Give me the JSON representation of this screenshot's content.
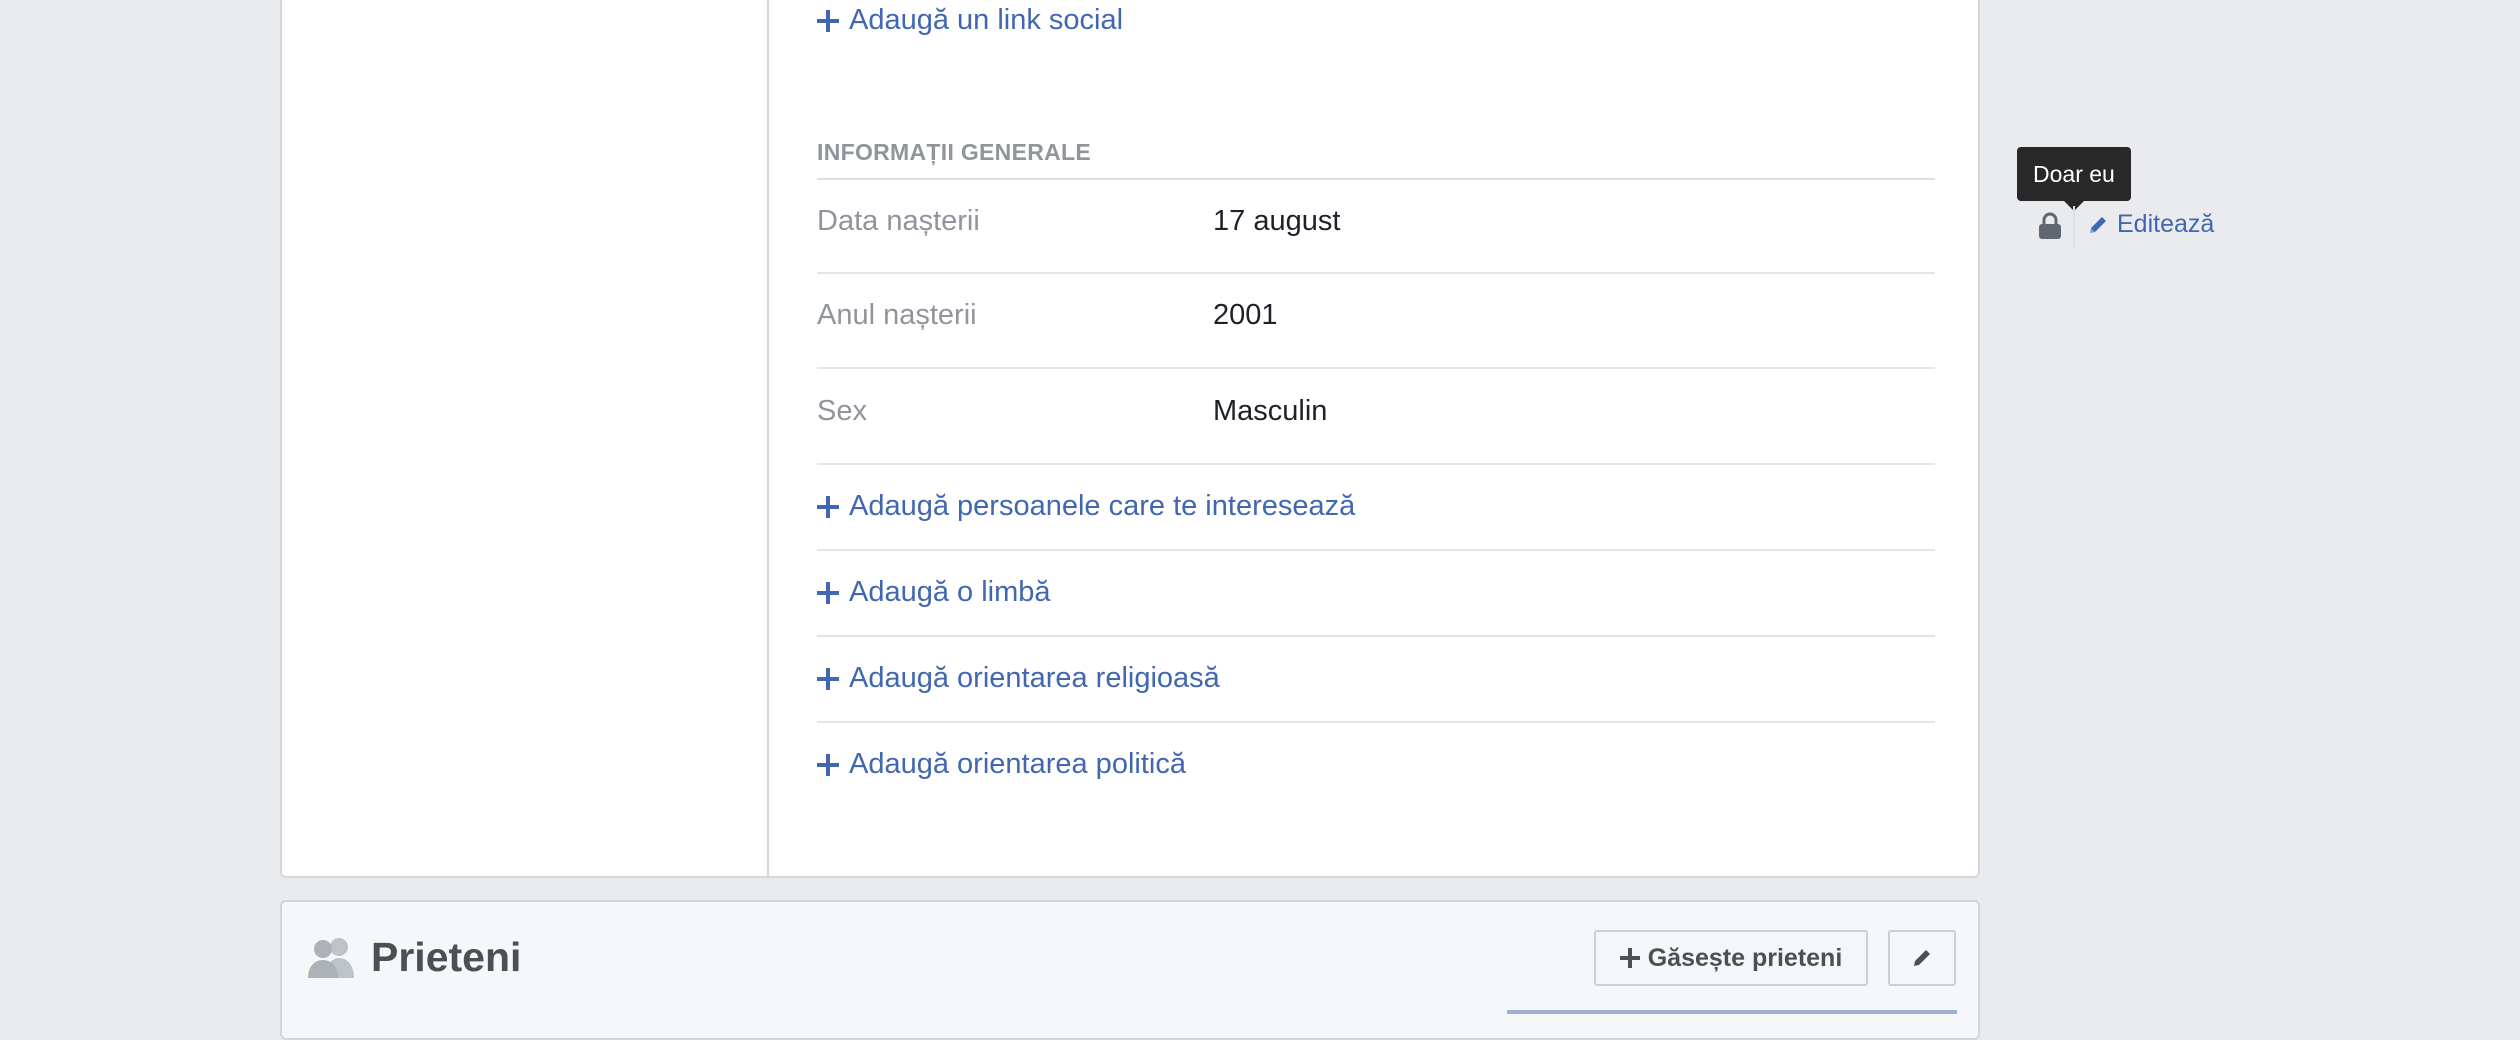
{
  "about": {
    "add_social_link": "Adaugă un link social",
    "section_title": "INFORMAȚII GENERALE",
    "rows": [
      {
        "label": "Data nașterii",
        "value": "17 august"
      },
      {
        "label": "Anul nașterii",
        "value": "2001"
      },
      {
        "label": "Sex",
        "value": "Masculin"
      }
    ],
    "privacy_tooltip": "Doar eu",
    "privacy_icon": "lock-icon",
    "edit_label": "Editează",
    "add_links": [
      "Adaugă persoanele care te interesează",
      "Adaugă o limbă",
      "Adaugă orientarea religioasă",
      "Adaugă orientarea politică"
    ]
  },
  "friends": {
    "title": "Prieteni",
    "find_friends_label": "Găsește prieteni",
    "icons": [
      "friends-icon",
      "pencil-icon"
    ]
  },
  "colors": {
    "page_bg": "#e9ebee",
    "link": "#4267b2",
    "muted": "#90949c",
    "text": "#1d2129"
  }
}
